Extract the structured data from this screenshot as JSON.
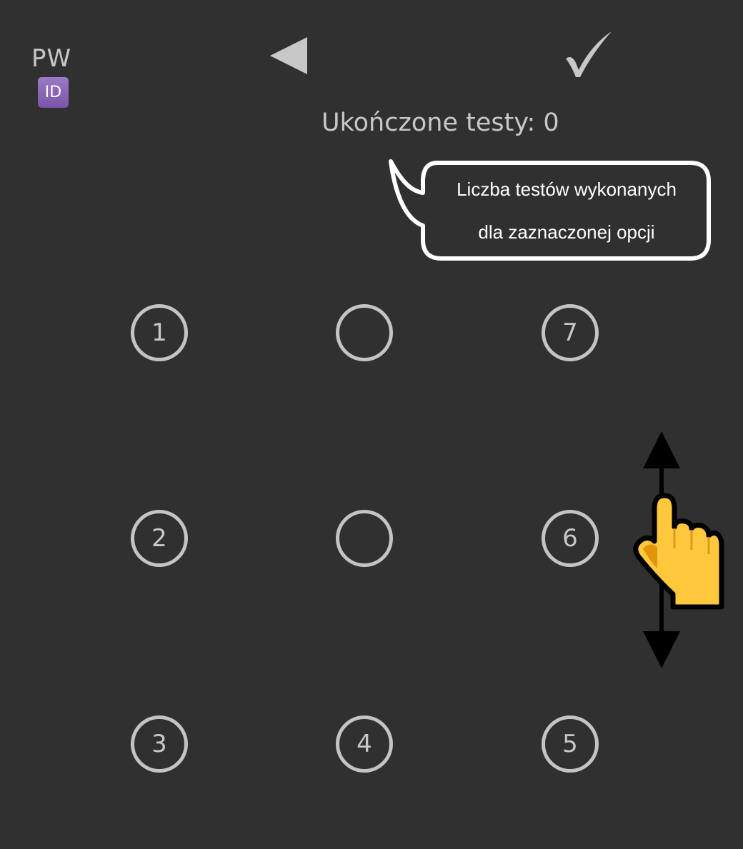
{
  "header": {
    "app_label": "PW",
    "id_badge": "ID",
    "back_icon": "left-triangle-icon",
    "confirm_icon": "checkmark-icon"
  },
  "status": {
    "completed_tests": "Ukończone testy: 0"
  },
  "tooltip": {
    "line1": "Liczba testów wykonanych",
    "line2": "dla zaznaczonej opcji"
  },
  "grid": {
    "r1c1": "1",
    "r1c2": "",
    "r1c3": "7",
    "r2c1": "2",
    "r2c2": "",
    "r2c3": "6",
    "r3c1": "3",
    "r3c2": "4",
    "r3c3": "5"
  },
  "gesture": {
    "icon": "swipe-vertical-hand-icon"
  },
  "colors": {
    "background": "#303030",
    "text": "#c8c8c8",
    "circle_border": "#c4c4c4",
    "id_badge": "#8a64b8",
    "hand": "#ffc83d"
  }
}
